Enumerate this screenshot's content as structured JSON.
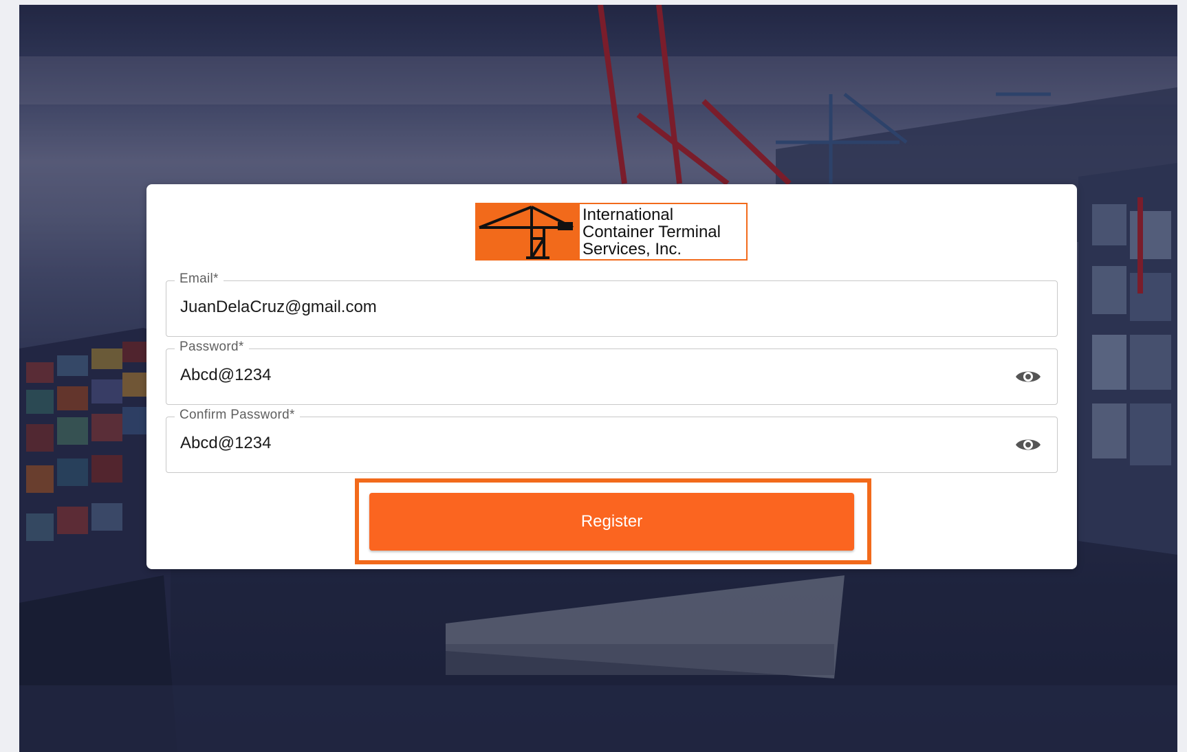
{
  "logo": {
    "lines": [
      "International",
      "Container Terminal",
      "Services, Inc."
    ],
    "icon": "crane-icon",
    "brand_color": "#f26a1b"
  },
  "form": {
    "email": {
      "label": "Email*",
      "value": "JuanDelaCruz@gmail.com"
    },
    "password": {
      "label": "Password*",
      "value": "Abcd@1234",
      "toggle_icon": "eye-icon"
    },
    "confirm_password": {
      "label": "Confirm Password*",
      "value": "Abcd@1234",
      "toggle_icon": "eye-icon"
    },
    "submit_label": "Register"
  },
  "colors": {
    "button": "#fb6520",
    "highlight": "#f26a1b"
  }
}
